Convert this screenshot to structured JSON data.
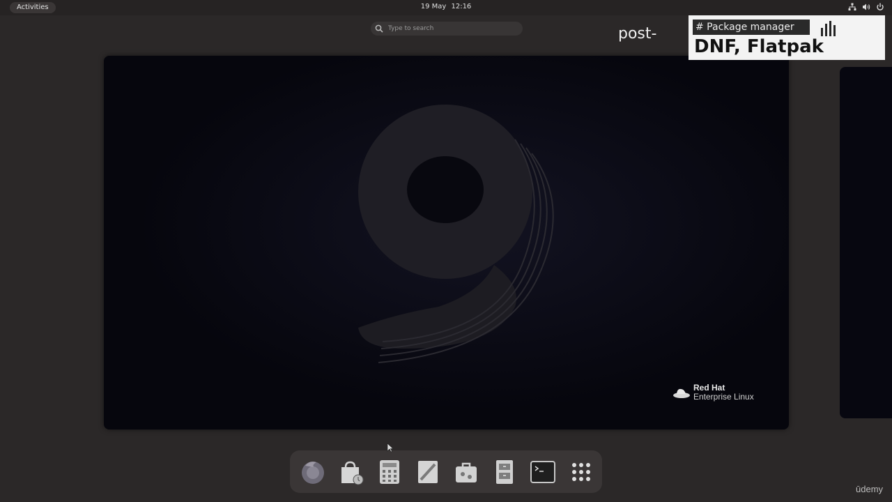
{
  "topbar": {
    "activities_label": "Activities",
    "date": "19 May",
    "time": "12:16",
    "tray_icons": [
      "network-icon",
      "volume-icon",
      "power-icon"
    ]
  },
  "search": {
    "placeholder": "Type to search"
  },
  "workspace": {
    "wallpaper_numeral": "9",
    "brand": "Red Hat",
    "product": "Enterprise Linux"
  },
  "overlay": {
    "text": "post-",
    "caption_tag": "# Package manager",
    "caption_title": "DNF, Flatpak"
  },
  "dock": {
    "items": [
      {
        "name": "firefox-icon",
        "label": "Firefox"
      },
      {
        "name": "software-icon",
        "label": "Software"
      },
      {
        "name": "calculator-icon",
        "label": "Calculator"
      },
      {
        "name": "text-editor-icon",
        "label": "Text Editor"
      },
      {
        "name": "toolbox-icon",
        "label": "Tools"
      },
      {
        "name": "files-icon",
        "label": "Files"
      },
      {
        "name": "terminal-icon",
        "label": "Terminal"
      },
      {
        "name": "app-grid-icon",
        "label": "Show Applications"
      }
    ]
  },
  "watermark": "ūdemy",
  "colors": {
    "background": "#2b2828",
    "dock": "#3a3636",
    "wallpaper": "#080812"
  }
}
